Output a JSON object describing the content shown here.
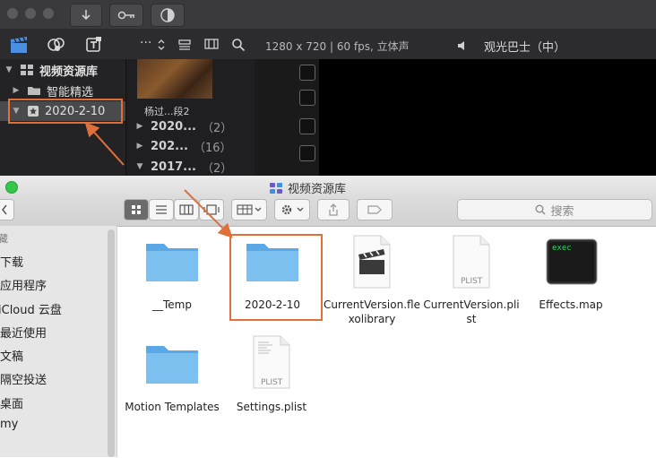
{
  "viewer": {
    "format": "1280 x 720 | 60 fps, 立体声",
    "project": "观光巴士（中）"
  },
  "library": {
    "name": "视频资源库",
    "items": [
      {
        "label": "智能精选"
      },
      {
        "label": "2020-2-10"
      }
    ]
  },
  "browser": {
    "clip_name": "杨过...段2",
    "events": [
      {
        "label": "2020...",
        "count": "（2）"
      },
      {
        "label": "202...",
        "count": "（16）"
      },
      {
        "label": "2017...",
        "count": "（2）"
      }
    ],
    "overflow_icon": "···"
  },
  "finder": {
    "title": "视频资源库",
    "search_placeholder": "搜索",
    "sidebar": [
      "藏",
      "下载",
      "应用程序",
      "iCloud 云盘",
      "最近使用",
      "文稿",
      "隔空投送",
      "桌面",
      "my"
    ],
    "items": [
      {
        "label": "__Temp",
        "kind": "folder"
      },
      {
        "label": "2020-2-10",
        "kind": "folder"
      },
      {
        "label": "CurrentVersion.flexolibrary",
        "line1": "CurrentVersion.fle",
        "line2": "xolibrary",
        "kind": "fcp"
      },
      {
        "label": "CurrentVersion.plist",
        "line1": "CurrentVersion.pli",
        "line2": "st",
        "kind": "plist"
      },
      {
        "label": "Effects.map",
        "kind": "exec"
      },
      {
        "label": "Motion Templates",
        "kind": "folder"
      },
      {
        "label": "Settings.plist",
        "kind": "plist"
      }
    ],
    "plist_badge": "PLIST",
    "exec_badge": "exec"
  },
  "colors": {
    "highlight": "#e0703a",
    "folder": "#6fb7ea"
  }
}
